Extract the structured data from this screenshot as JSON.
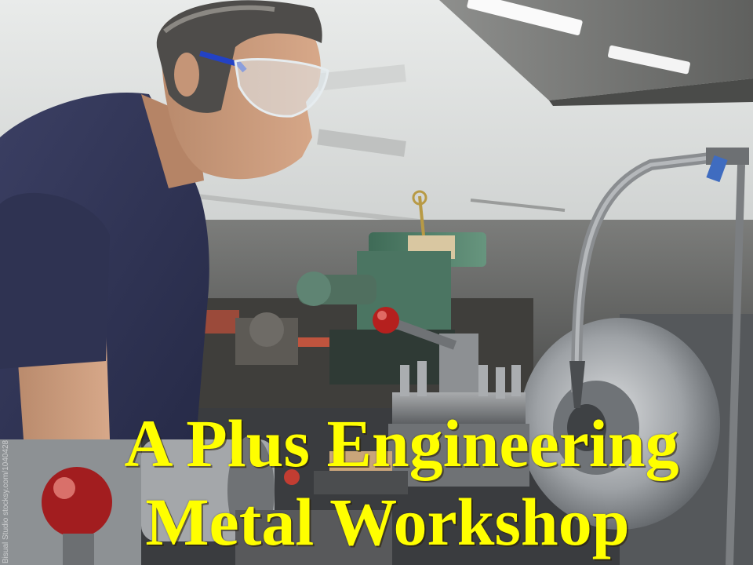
{
  "caption": {
    "line1": "A Plus Engineering",
    "line2": "Metal Workshop",
    "color": "#ffff00"
  },
  "photo_credit": "Bisual Studio stocksy.com/1040428",
  "photo": {
    "description_icon": "machinist-at-lathe-photo"
  }
}
